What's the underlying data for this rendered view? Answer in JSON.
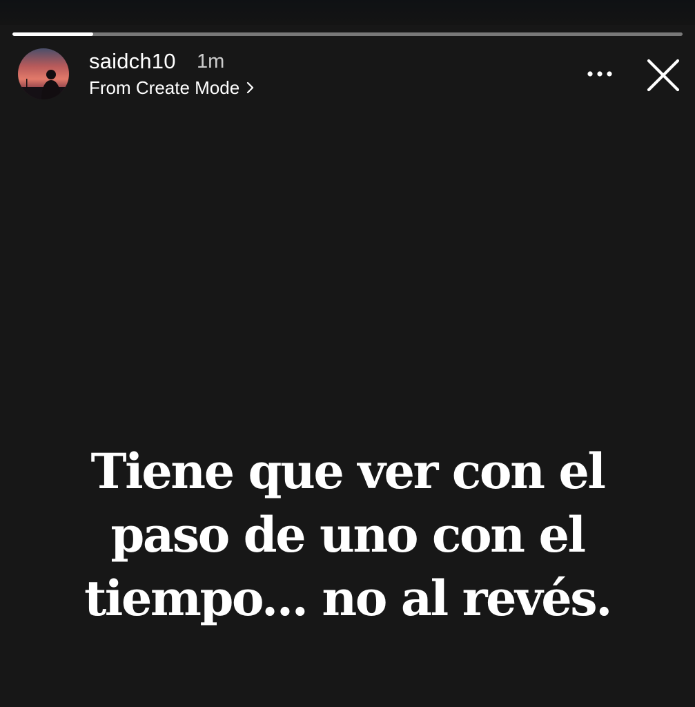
{
  "story": {
    "progress": 0.12,
    "header": {
      "username": "saidch10",
      "timestamp": "1m",
      "source_label": "From Create Mode",
      "avatar_icon": "profile-avatar",
      "more_icon": "more-dots-icon",
      "close_icon": "close-icon"
    },
    "text_lines": [
      "Tiene que ver con el",
      "paso de uno con el",
      "tiempo... no al revés."
    ],
    "colors": {
      "background": "#171717",
      "text": "#ffffff",
      "progress_track": "#6b6b6b",
      "progress_fill": "#ffffff"
    }
  }
}
